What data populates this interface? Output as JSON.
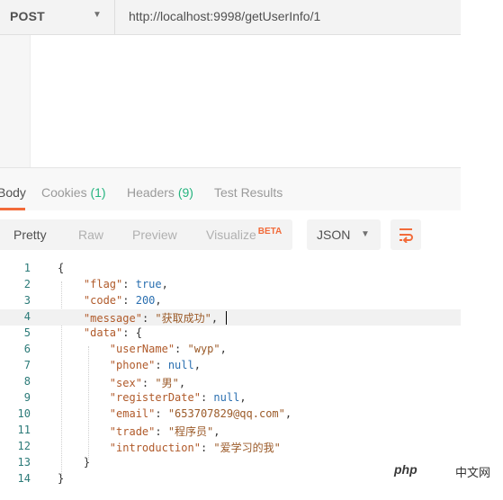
{
  "request": {
    "method": "POST",
    "url": "http://localhost:9998/getUserInfo/1"
  },
  "response_tabs": [
    {
      "label": "Body",
      "count": "",
      "active": true
    },
    {
      "label": "Cookies",
      "count": "(1)",
      "active": false
    },
    {
      "label": "Headers",
      "count": "(9)",
      "active": false
    },
    {
      "label": "Test Results",
      "count": "",
      "active": false
    }
  ],
  "view_options": [
    {
      "label": "Pretty",
      "active": true
    },
    {
      "label": "Raw",
      "active": false
    },
    {
      "label": "Preview",
      "active": false
    },
    {
      "label": "Visualize",
      "badge": "BETA",
      "active": false
    }
  ],
  "format": "JSON",
  "icons": {
    "method_dropdown": "chevron-down-icon",
    "format_dropdown": "chevron-down-icon",
    "wrap": "wrap-lines-icon"
  },
  "colors": {
    "accent": "#f26b3a",
    "count": "#26b47f",
    "key": "#b05a2a",
    "number": "#2a6fb0"
  },
  "code_lines": [
    {
      "n": "1",
      "text": "{"
    },
    {
      "n": "2",
      "text": "    \"flag\": true,"
    },
    {
      "n": "3",
      "text": "    \"code\": 200,"
    },
    {
      "n": "4",
      "text": "    \"message\": \"获取成功\","
    },
    {
      "n": "5",
      "text": "    \"data\": {"
    },
    {
      "n": "6",
      "text": "        \"userName\": \"wyp\","
    },
    {
      "n": "7",
      "text": "        \"phone\": null,"
    },
    {
      "n": "8",
      "text": "        \"sex\": \"男\","
    },
    {
      "n": "9",
      "text": "        \"registerDate\": null,"
    },
    {
      "n": "10",
      "text": "        \"email\": \"653707829@qq.com\","
    },
    {
      "n": "11",
      "text": "        \"trade\": \"程序员\","
    },
    {
      "n": "12",
      "text": "        \"introduction\": \"爱学习的我\""
    },
    {
      "n": "13",
      "text": "    }"
    },
    {
      "n": "14",
      "text": "}"
    }
  ],
  "watermark": {
    "logo_text": "php",
    "site": "中文网"
  }
}
